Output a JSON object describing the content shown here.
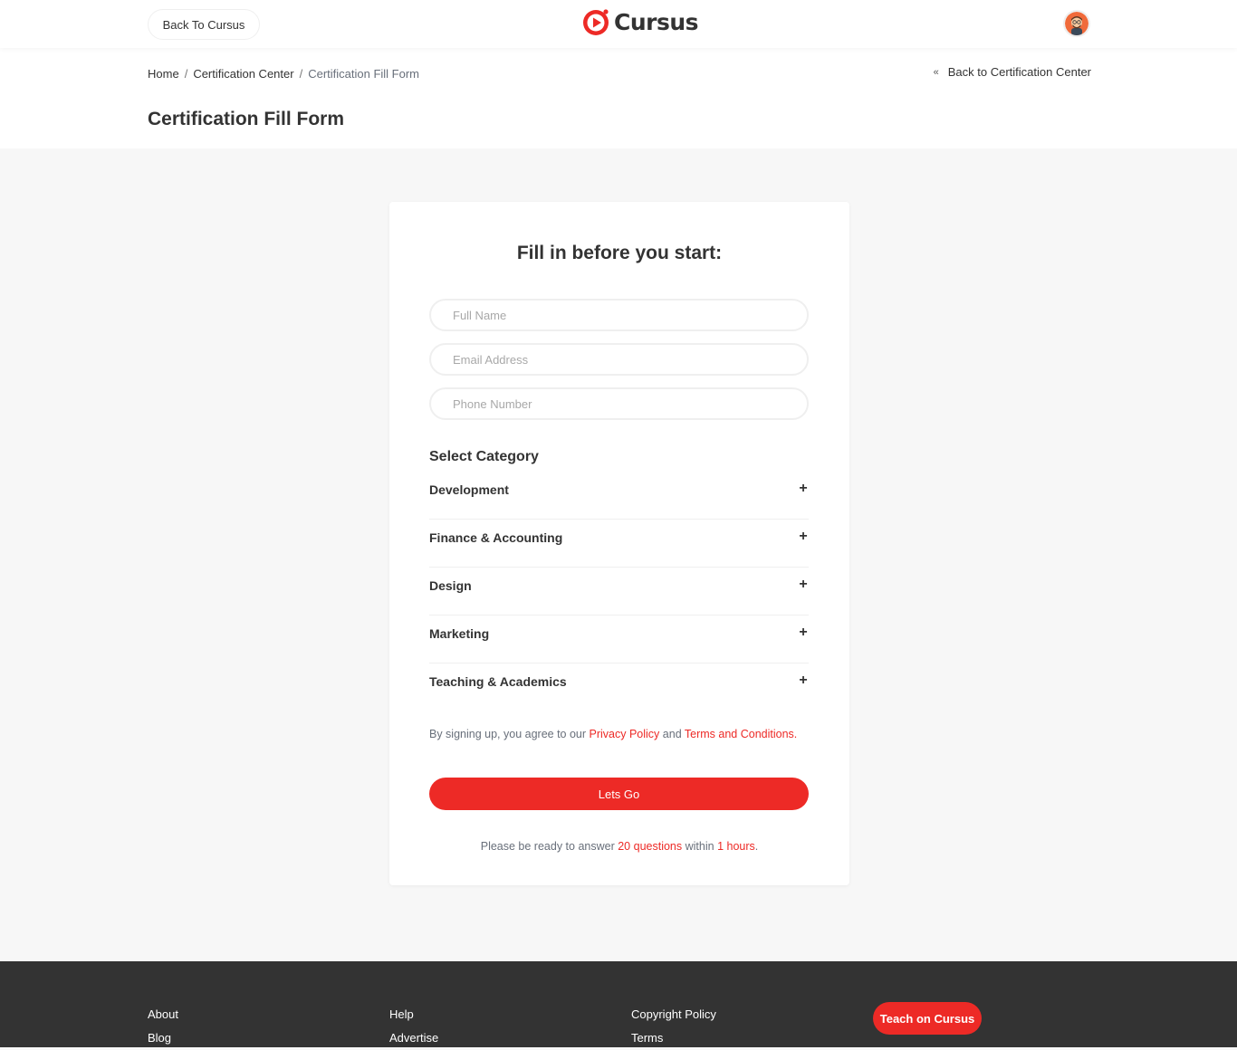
{
  "header": {
    "back_button": "Back To Cursus",
    "logo_text": "Cursus",
    "brand_color": "#ed2a26"
  },
  "breadcrumb": {
    "items": [
      "Home",
      "Certification Center",
      "Certification Fill Form"
    ],
    "separator": "/"
  },
  "back_link": {
    "icon": "«",
    "label": "Back to Certification Center"
  },
  "page_title": "Certification Fill Form",
  "form": {
    "title": "Fill in before you start:",
    "fields": [
      {
        "placeholder": "Full Name",
        "value": ""
      },
      {
        "placeholder": "Email Address",
        "value": ""
      },
      {
        "placeholder": "Phone Number",
        "value": ""
      }
    ],
    "category_label": "Select Category",
    "categories": [
      {
        "name": "Development",
        "icon": "+"
      },
      {
        "name": "Finance & Accounting",
        "icon": "+"
      },
      {
        "name": "Design",
        "icon": "+"
      },
      {
        "name": "Marketing",
        "icon": "+"
      },
      {
        "name": "Teaching & Academics",
        "icon": "+"
      }
    ],
    "agree": {
      "prefix": "By signing up, you agree to our",
      "privacy": "Privacy Policy",
      "and": "and",
      "terms": "Terms and Conditions."
    },
    "submit": "Lets Go",
    "ready": {
      "prefix": "Please be ready to answer",
      "questions": "20 questions",
      "within": "within",
      "hours": "1 hours",
      "suffix": "."
    }
  },
  "footer": {
    "col1": [
      "About",
      "Blog"
    ],
    "col2": [
      "Help",
      "Advertise"
    ],
    "col3": [
      "Copyright Policy",
      "Terms"
    ],
    "teach_button": "Teach on Cursus"
  }
}
